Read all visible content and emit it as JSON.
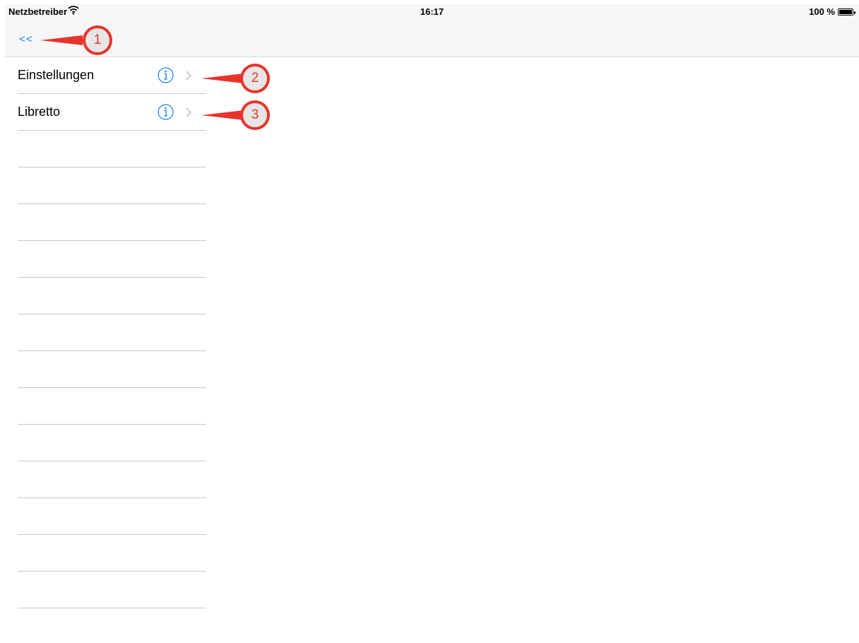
{
  "status_bar": {
    "carrier": "Netzbetreiber",
    "time": "16:17",
    "battery_text": "100 %",
    "battery_level": 1.0
  },
  "nav": {
    "back_label": "<<"
  },
  "list": {
    "items": [
      {
        "label": "Einstellungen",
        "info_icon": "info-circle-icon",
        "chevron_icon": "chevron-right-icon"
      },
      {
        "label": "Libretto",
        "info_icon": "info-circle-icon",
        "chevron_icon": "chevron-right-icon"
      }
    ],
    "empty_rows": 13
  },
  "callouts": [
    "1",
    "2",
    "3"
  ],
  "colors": {
    "accent": "#147efb",
    "callout_red": "#e8332d",
    "separator": "#c8c7cc",
    "bar_bg": "#f7f7f7"
  }
}
